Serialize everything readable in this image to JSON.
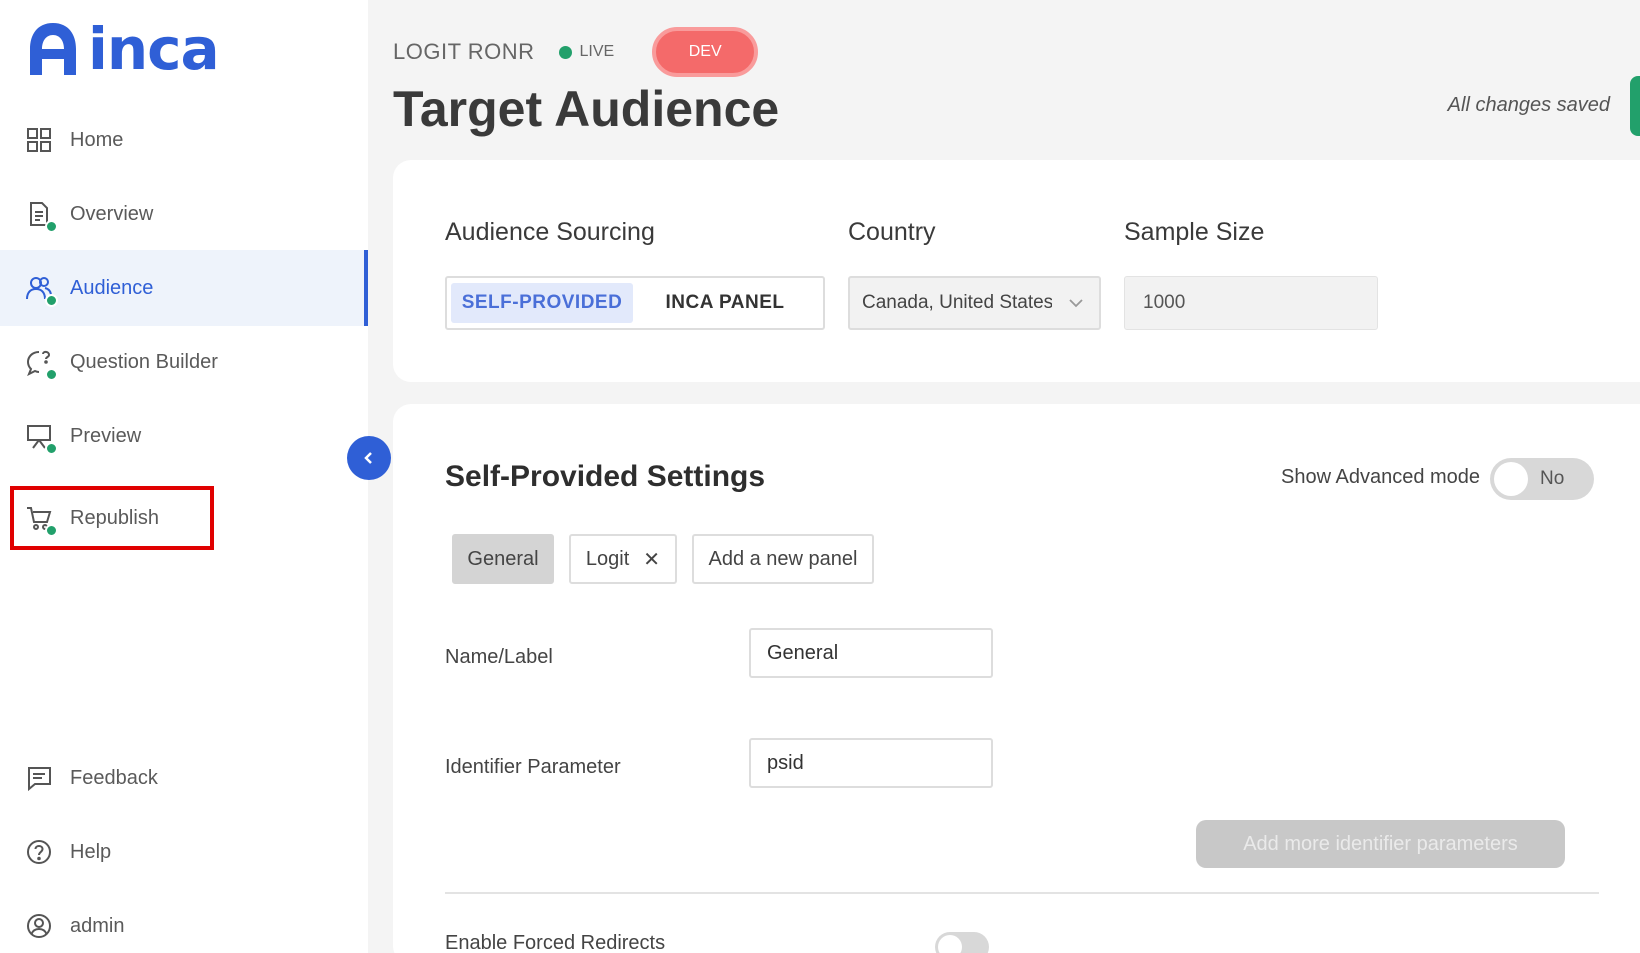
{
  "brand": {
    "logo_text": "inca",
    "accent": "#2f5fd6"
  },
  "sidebar": {
    "items": [
      {
        "label": "Home",
        "icon": "grid-icon"
      },
      {
        "label": "Overview",
        "icon": "document-icon"
      },
      {
        "label": "Audience",
        "icon": "users-icon",
        "active": true
      },
      {
        "label": "Question Builder",
        "icon": "question-bubble-icon"
      },
      {
        "label": "Preview",
        "icon": "presentation-icon"
      },
      {
        "label": "Republish",
        "icon": "cart-icon",
        "highlighted": true
      },
      {
        "label": "Feedback",
        "icon": "message-icon"
      },
      {
        "label": "Help",
        "icon": "help-icon"
      },
      {
        "label": "admin",
        "icon": "user-circle-icon"
      }
    ]
  },
  "header": {
    "project_name": "LOGIT RONR",
    "status_label": "LIVE",
    "env_badge": "DEV",
    "title": "Target Audience",
    "save_status": "All changes saved"
  },
  "audience": {
    "sourcing_label": "Audience Sourcing",
    "sourcing_options": [
      "SELF-PROVIDED",
      "INCA PANEL"
    ],
    "sourcing_selected": "SELF-PROVIDED",
    "country_label": "Country",
    "country_value": "Canada, United States",
    "sample_label": "Sample Size",
    "sample_value": "1000"
  },
  "settings": {
    "title": "Self-Provided Settings",
    "advanced_label": "Show Advanced mode",
    "advanced_value": "No",
    "tabs": [
      "General",
      "Logit",
      "Add a new panel"
    ],
    "tab_selected": "General",
    "name_label": "Name/Label",
    "name_value": "General",
    "identifier_label": "Identifier Parameter",
    "identifier_value": "psid",
    "add_identifier_button": "Add more identifier parameters",
    "forced_redirects_label": "Enable Forced Redirects"
  }
}
